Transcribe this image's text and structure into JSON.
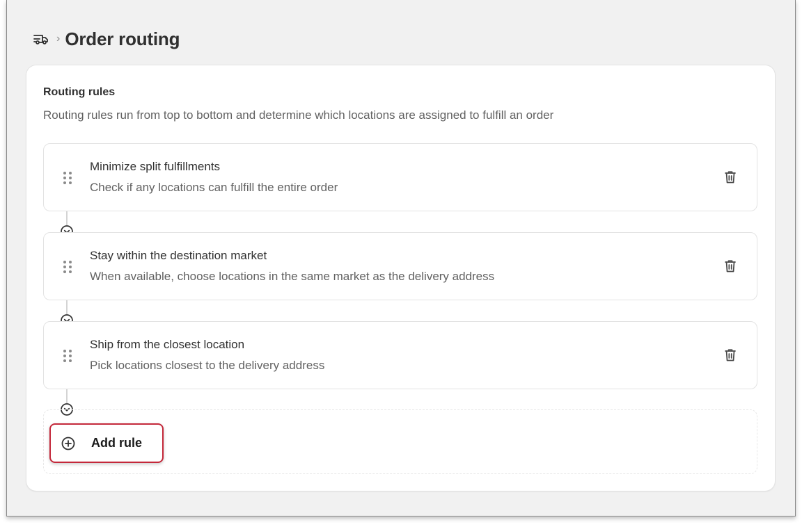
{
  "header": {
    "icon": "shipping-truck-icon",
    "separator": "›",
    "title": "Order routing"
  },
  "card": {
    "title": "Routing rules",
    "subtitle": "Routing rules run from top to bottom and determine which locations are assigned to fulfill an order"
  },
  "rules": [
    {
      "title": "Minimize split fulfillments",
      "description": "Check if any locations can fulfill the entire order"
    },
    {
      "title": "Stay within the destination market",
      "description": "When available, choose locations in the same market as the delivery address"
    },
    {
      "title": "Ship from the closest location",
      "description": "Pick locations closest to the delivery address"
    }
  ],
  "add_rule": {
    "label": "Add rule",
    "icon": "plus-circle-icon"
  },
  "colors": {
    "highlight_border": "#c4283a",
    "background": "#f1f1f1",
    "card": "#ffffff",
    "text_primary": "#303030",
    "text_secondary": "#616161"
  }
}
